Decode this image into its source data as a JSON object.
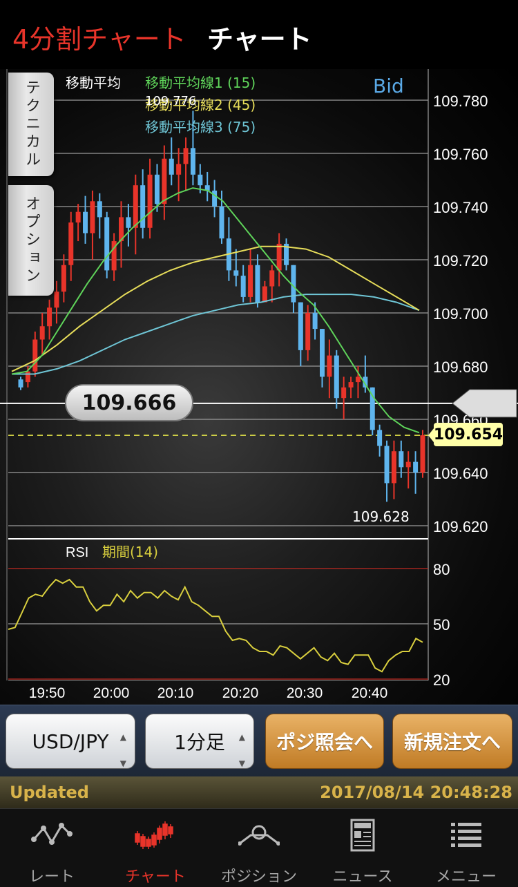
{
  "header": {
    "tab_4split": "4分割チャート",
    "tab_chart": "チャート"
  },
  "side_tabs": {
    "technical": "テクニカル",
    "option": "オプション"
  },
  "legend": {
    "label": "移動平均",
    "ma1": "移動平均線1 (15)",
    "ma2": "移動平均線2 (45)",
    "ma3": "移動平均線3 (75)",
    "high_label": "109.776",
    "low_label": "109.628",
    "bid": "Bid",
    "ma1_color": "#5fd45a",
    "ma2_color": "#e7dd5a",
    "ma3_color": "#6fc6d6"
  },
  "price_axis": [
    "109.780",
    "109.760",
    "109.740",
    "109.720",
    "109.700",
    "109.680",
    "109.660",
    "109.640",
    "109.620"
  ],
  "current_price": "109.666",
  "bid_price": "109.654",
  "rsi": {
    "label": "RSI",
    "period": "期間(14)",
    "levels": [
      "80",
      "50",
      "20"
    ],
    "color": "#d9cf3e"
  },
  "time_axis": [
    "19:50",
    "20:00",
    "20:10",
    "20:20",
    "20:30",
    "20:40"
  ],
  "chart_data": {
    "type": "line",
    "title": "",
    "price_range": [
      109.62,
      109.78
    ],
    "rsi_range": [
      20,
      80
    ],
    "candles": [
      [
        109.675,
        109.676,
        109.671,
        109.672
      ],
      [
        109.674,
        109.68,
        109.672,
        109.678
      ],
      [
        109.678,
        109.693,
        109.676,
        109.69
      ],
      [
        109.69,
        109.7,
        109.684,
        109.695
      ],
      [
        109.695,
        109.705,
        109.69,
        109.702
      ],
      [
        109.702,
        109.712,
        109.696,
        109.708
      ],
      [
        109.708,
        109.722,
        109.704,
        109.718
      ],
      [
        109.718,
        109.738,
        109.712,
        109.734
      ],
      [
        109.734,
        109.741,
        109.727,
        109.738
      ],
      [
        109.738,
        109.744,
        109.726,
        109.73
      ],
      [
        109.73,
        109.746,
        109.72,
        109.742
      ],
      [
        109.742,
        109.745,
        109.728,
        109.736
      ],
      [
        109.736,
        109.738,
        109.713,
        109.716
      ],
      [
        109.716,
        109.73,
        109.712,
        109.727
      ],
      [
        109.727,
        109.742,
        109.717,
        109.736
      ],
      [
        109.736,
        109.741,
        109.725,
        109.732
      ],
      [
        109.732,
        109.752,
        109.722,
        109.748
      ],
      [
        109.748,
        109.754,
        109.728,
        109.732
      ],
      [
        109.732,
        109.758,
        109.728,
        109.752
      ],
      [
        109.752,
        109.756,
        109.738,
        109.741
      ],
      [
        109.741,
        109.763,
        109.735,
        109.758
      ],
      [
        109.758,
        109.766,
        109.748,
        109.752
      ],
      [
        109.752,
        109.762,
        109.742,
        109.756
      ],
      [
        109.756,
        109.766,
        109.746,
        109.762
      ],
      [
        109.762,
        109.776,
        109.748,
        109.752
      ],
      [
        109.752,
        109.756,
        109.745,
        109.748
      ],
      [
        109.748,
        109.753,
        109.742,
        109.746
      ],
      [
        109.746,
        109.75,
        109.736,
        109.74
      ],
      [
        109.74,
        109.746,
        109.726,
        109.728
      ],
      [
        109.728,
        109.736,
        109.712,
        109.716
      ],
      [
        109.716,
        109.724,
        109.71,
        109.714
      ],
      [
        109.714,
        109.718,
        109.704,
        109.706
      ],
      [
        109.706,
        109.724,
        109.704,
        109.718
      ],
      [
        109.718,
        109.722,
        109.702,
        109.704
      ],
      [
        109.704,
        109.712,
        109.706,
        109.71
      ],
      [
        109.71,
        109.718,
        109.704,
        109.716
      ],
      [
        109.716,
        109.73,
        109.71,
        109.726
      ],
      [
        109.726,
        109.728,
        109.716,
        109.718
      ],
      [
        109.718,
        109.718,
        109.7,
        109.704
      ],
      [
        109.704,
        109.704,
        109.68,
        109.686
      ],
      [
        109.686,
        109.703,
        109.682,
        109.7
      ],
      [
        109.7,
        109.704,
        109.69,
        109.694
      ],
      [
        109.694,
        109.694,
        109.672,
        109.676
      ],
      [
        109.676,
        109.69,
        109.668,
        109.684
      ],
      [
        109.684,
        109.686,
        109.664,
        109.668
      ],
      [
        109.668,
        109.676,
        109.66,
        109.672
      ],
      [
        109.672,
        109.676,
        109.668,
        109.674
      ],
      [
        109.674,
        109.68,
        109.668,
        109.676
      ],
      [
        109.676,
        109.684,
        109.67,
        109.672
      ],
      [
        109.672,
        109.672,
        109.654,
        109.656
      ],
      [
        109.656,
        109.658,
        109.646,
        109.65
      ],
      [
        109.65,
        109.652,
        109.629,
        109.636
      ],
      [
        109.636,
        109.652,
        109.63,
        109.648
      ],
      [
        109.648,
        109.652,
        109.638,
        109.642
      ],
      [
        109.642,
        109.648,
        109.634,
        109.644
      ],
      [
        109.644,
        109.648,
        109.632,
        109.64
      ],
      [
        109.64,
        109.656,
        109.638,
        109.654
      ]
    ],
    "ma1": [
      109.677,
      109.678,
      109.684,
      109.693,
      109.702,
      109.711,
      109.719,
      109.726,
      109.732,
      109.737,
      109.742,
      109.745,
      109.747,
      109.746,
      109.742,
      109.735,
      109.728,
      109.721,
      109.714,
      109.708,
      109.703,
      109.695,
      109.686,
      109.677,
      109.668,
      109.661,
      109.657,
      109.655
    ],
    "ma2": [
      109.678,
      109.682,
      109.688,
      109.695,
      109.701,
      109.707,
      109.712,
      109.716,
      109.719,
      109.721,
      109.723,
      109.725,
      109.725,
      109.724,
      109.721,
      109.716,
      109.711,
      109.706,
      109.701
    ],
    "ma3": [
      109.677,
      109.677,
      109.679,
      109.682,
      109.686,
      109.69,
      109.693,
      109.696,
      109.699,
      109.701,
      109.703,
      109.704,
      109.706,
      109.707,
      109.707,
      109.707,
      109.706,
      109.704,
      109.701
    ],
    "rsi": [
      47,
      48,
      56,
      64,
      66,
      65,
      70,
      74,
      72,
      74,
      70,
      70,
      62,
      57,
      60,
      60,
      66,
      62,
      68,
      64,
      67,
      67,
      64,
      68,
      65,
      63,
      70,
      62,
      60,
      57,
      54,
      54,
      46,
      41,
      42,
      41,
      37,
      35,
      35,
      33,
      38,
      37,
      34,
      31,
      34,
      37,
      32,
      30,
      34,
      29,
      28,
      33,
      33,
      33,
      26,
      24,
      30,
      33,
      35,
      35,
      42,
      40
    ]
  },
  "controls": {
    "pair": "USD/JPY",
    "timeframe": "1分足",
    "positions_btn": "ポジ照会へ",
    "new_order_btn": "新規注文へ"
  },
  "status": {
    "updated": "Updated",
    "timestamp": "2017/08/14 20:48:28"
  },
  "tabbar": [
    {
      "label": "レート",
      "icon": "rate-line-icon"
    },
    {
      "label": "チャート",
      "icon": "candle-chart-icon"
    },
    {
      "label": "ポジション",
      "icon": "position-icon"
    },
    {
      "label": "ニュース",
      "icon": "news-icon"
    },
    {
      "label": "メニュー",
      "icon": "menu-list-icon"
    }
  ]
}
